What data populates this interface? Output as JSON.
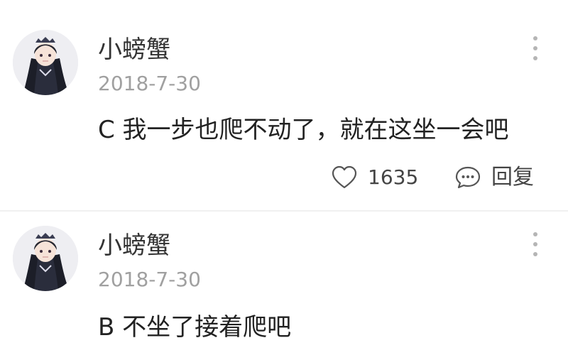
{
  "comments": [
    {
      "username": "小螃蟹",
      "date": "2018-7-30",
      "text": "C 我一步也爬不动了，就在这坐一会吧",
      "likes": "1635",
      "reply_label": "回复"
    },
    {
      "username": "小螃蟹",
      "date": "2018-7-30",
      "text": "B 不坐了接着爬吧"
    }
  ],
  "icons": {
    "avatar": "avatar-anime-girl",
    "more": "more-vertical-icon",
    "like": "heart-outline-icon",
    "reply": "chat-bubble-icon"
  },
  "colors": {
    "username": "#333333",
    "date": "#a0a0a0",
    "text": "#222222",
    "icon": "#555555"
  }
}
